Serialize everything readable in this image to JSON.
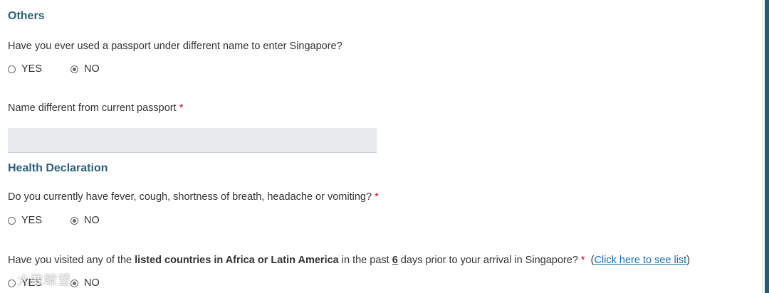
{
  "others": {
    "title": "Others",
    "q1": {
      "text": "Have you ever used a passport under different name to enter Singapore?",
      "options": [
        "YES",
        "NO"
      ],
      "selected": "NO"
    },
    "name_field": {
      "label": "Name different from current passport",
      "required_mark": "*",
      "value": ""
    }
  },
  "health": {
    "title": "Health Declaration",
    "q1": {
      "text": "Do you currently have fever, cough, shortness of breath, headache or vomiting?",
      "required_mark": "*",
      "options": [
        "YES",
        "NO"
      ],
      "selected": "NO"
    },
    "q2": {
      "text_part1": "Have you visited any of the ",
      "text_bold": "listed countries in Africa or Latin America",
      "text_part2": " in the past ",
      "text_days": "6",
      "text_part3": " days prior to your arrival in Singapore?",
      "required_mark": "*",
      "paren_open": "(",
      "link_text": "Click here to see list",
      "paren_close": ")",
      "options": [
        "YES",
        "NO"
      ],
      "selected": "NO"
    }
  },
  "watermark": "大数瞭望",
  "colors": {
    "heading": "#2c5f7d",
    "required": "#d0021b",
    "link": "#1a6fb3",
    "field_bg": "#e8ebee"
  }
}
